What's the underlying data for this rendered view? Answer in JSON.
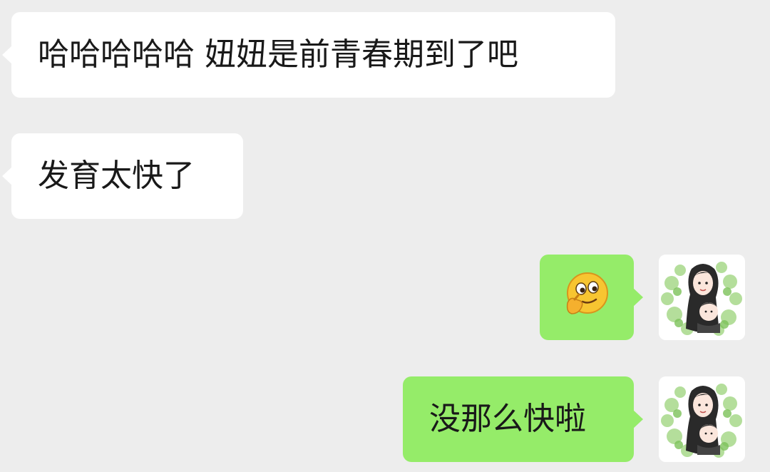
{
  "messages": [
    {
      "side": "received",
      "text": "哈哈哈哈哈 妞妞是前青春期到了吧"
    },
    {
      "side": "received",
      "text": "发育太快了"
    },
    {
      "side": "sent",
      "type": "emoji",
      "emoji_name": "thinking-face-emoji"
    },
    {
      "side": "sent",
      "text": "没那么快啦"
    }
  ],
  "colors": {
    "background": "#ededed",
    "received_bubble": "#ffffff",
    "sent_bubble": "#95ec69",
    "text": "#191919"
  },
  "avatar_icon": "mother-and-child-avatar"
}
